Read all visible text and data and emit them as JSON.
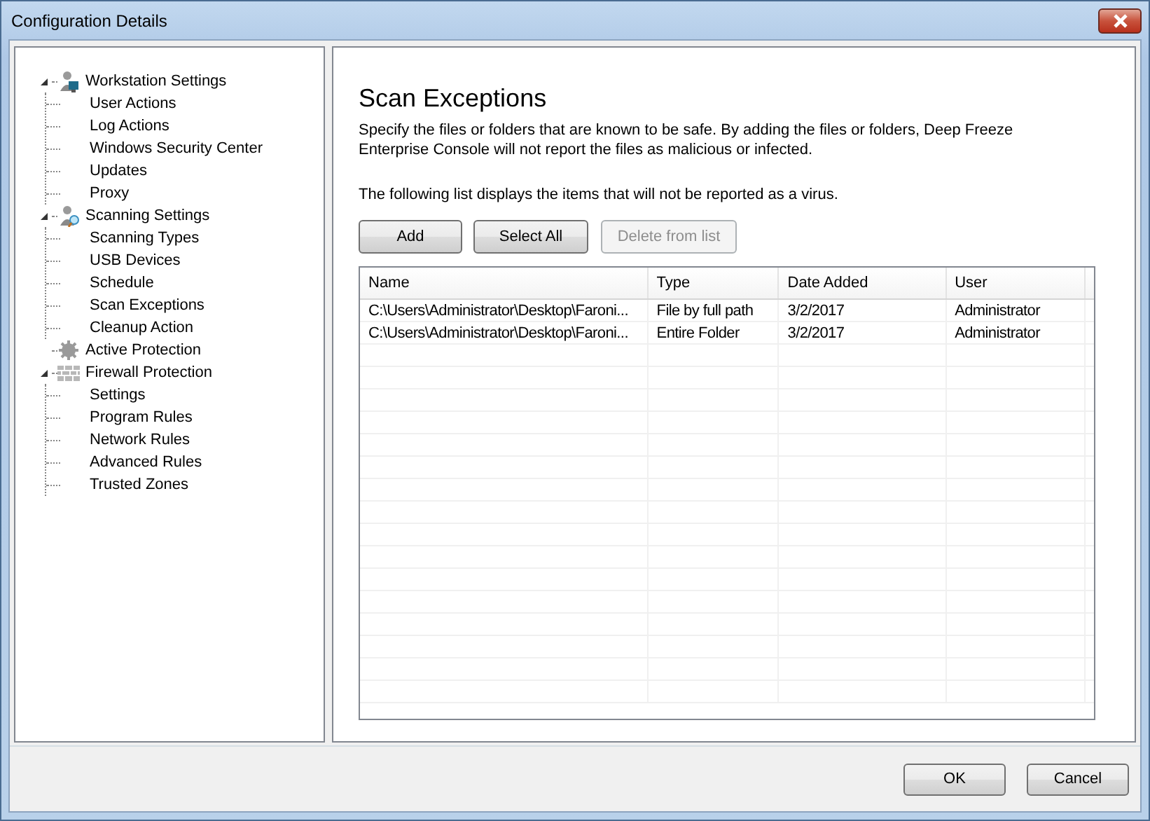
{
  "window": {
    "title": "Configuration Details"
  },
  "tree": [
    {
      "label": "Workstation Settings",
      "expanded": true,
      "children": [
        {
          "label": "User Actions"
        },
        {
          "label": "Log Actions"
        },
        {
          "label": "Windows Security Center"
        },
        {
          "label": "Updates"
        },
        {
          "label": "Proxy"
        }
      ]
    },
    {
      "label": "Scanning Settings",
      "expanded": true,
      "children": [
        {
          "label": "Scanning Types"
        },
        {
          "label": "USB Devices"
        },
        {
          "label": "Schedule"
        },
        {
          "label": "Scan Exceptions"
        },
        {
          "label": "Cleanup Action"
        }
      ]
    },
    {
      "label": "Active Protection"
    },
    {
      "label": "Firewall Protection",
      "expanded": true,
      "children": [
        {
          "label": "Settings"
        },
        {
          "label": "Program Rules"
        },
        {
          "label": "Network Rules"
        },
        {
          "label": "Advanced Rules"
        },
        {
          "label": "Trusted Zones"
        }
      ]
    }
  ],
  "page": {
    "heading": "Scan Exceptions",
    "description": "Specify the files or folders that are known to be safe. By adding the files or folders, Deep Freeze Enterprise Console will not report the files as malicious or infected.",
    "list_note": "The following list displays the items that will not be reported as a virus.",
    "buttons": [
      {
        "label": "Add",
        "disabled": false
      },
      {
        "label": "Select All",
        "disabled": false
      },
      {
        "label": "Delete from list",
        "disabled": true
      }
    ]
  },
  "table": {
    "columns": [
      "Name",
      "Type",
      "Date Added",
      "User"
    ],
    "rows": [
      [
        "C:\\Users\\Administrator\\Desktop\\Faroni...",
        "File by full path",
        "3/2/2017",
        "Administrator"
      ],
      [
        "C:\\Users\\Administrator\\Desktop\\Faroni...",
        "Entire Folder",
        "3/2/2017",
        "Administrator"
      ]
    ]
  },
  "footer_buttons": [
    "OK",
    "Cancel"
  ]
}
